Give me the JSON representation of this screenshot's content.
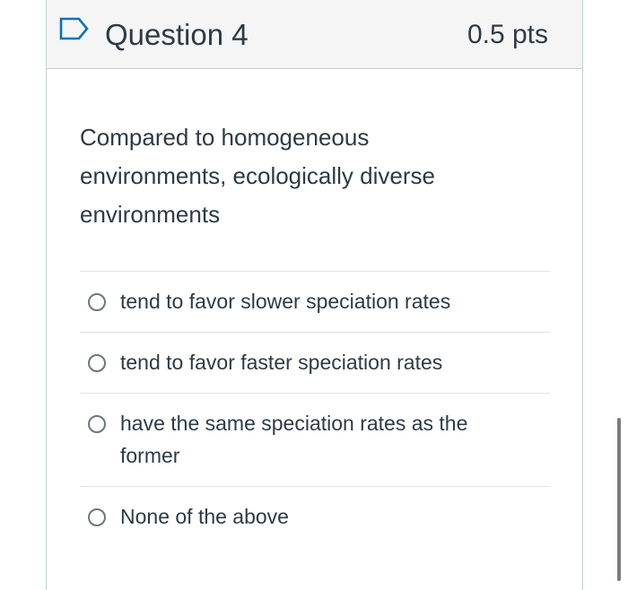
{
  "question": {
    "title": "Question 4",
    "points": "0.5 pts",
    "text": "Compared to homogeneous environments, ecologically diverse environments",
    "flag_icon": "flag-outline-icon"
  },
  "answers": [
    {
      "label": "tend to favor slower speciation rates",
      "icon": "radio-unchecked-icon"
    },
    {
      "label": "tend to favor faster speciation rates",
      "icon": "radio-unchecked-icon"
    },
    {
      "label": "have the same speciation rates as the former",
      "icon": "radio-unchecked-icon"
    },
    {
      "label": "None of the above",
      "icon": "radio-unchecked-icon"
    }
  ],
  "colors": {
    "text": "#2d3b45",
    "header_bg": "#f5f5f5",
    "flag_accent": "#0374b5",
    "border": "#c7cdd1"
  }
}
